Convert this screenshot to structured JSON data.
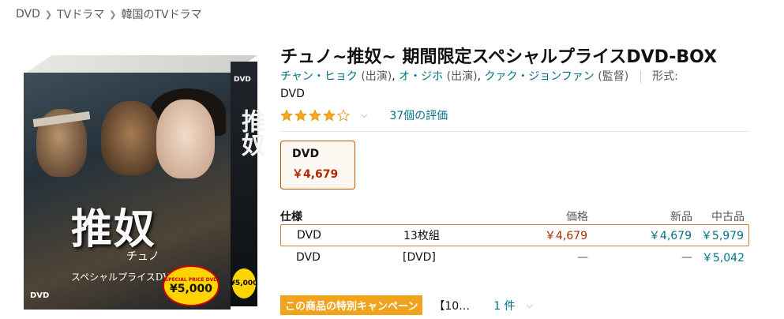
{
  "breadcrumb": [
    {
      "label": "DVD"
    },
    {
      "label": "TVドラマ"
    },
    {
      "label": "韓国のTVドラマ"
    }
  ],
  "product": {
    "title": "チュノ~推奴~ 期間限定スペシャルプライスDVD-BOX",
    "contributors": [
      {
        "name": "チャン・ヒョク",
        "role": "(出演)"
      },
      {
        "name": "オ・ジホ",
        "role": "(出演)"
      },
      {
        "name": "クァク・ジョンファン",
        "role": "(監督)"
      }
    ],
    "format_label": "形式:",
    "format_value": "DVD",
    "rating_stars": 4,
    "rating_count": "37個の評価"
  },
  "cover": {
    "title": "推奴",
    "subtitle": "チュノ",
    "caption": "スペシャルプライスDVD-BOX",
    "sticker_top": "SPECIAL PRICE DVD",
    "sticker_price": "¥5,000",
    "dvd_badge": "DVD",
    "side_title": "推奴",
    "side_price": "¥5,000"
  },
  "format_tile": {
    "name": "DVD",
    "price": "￥4,679"
  },
  "spec_table": {
    "headers": {
      "spec": "仕様",
      "price": "価格",
      "new": "新品",
      "used": "中古品"
    },
    "rows": [
      {
        "type": "DVD",
        "qty": "13枚組",
        "price": "￥4,679",
        "new": "￥4,679",
        "used": "￥5,979"
      },
      {
        "type": "DVD",
        "qty": "[DVD]",
        "price": "—",
        "new": "—",
        "used": "￥5,042"
      }
    ]
  },
  "campaign": {
    "badge": "この商品の特別キャンペーン",
    "promo": "【10…",
    "count": "1 件"
  },
  "colors": {
    "link": "#007185",
    "price": "#b12704",
    "star": "#f5a623",
    "selected_border": "#d47c3a",
    "badge": "#f0a31c"
  }
}
